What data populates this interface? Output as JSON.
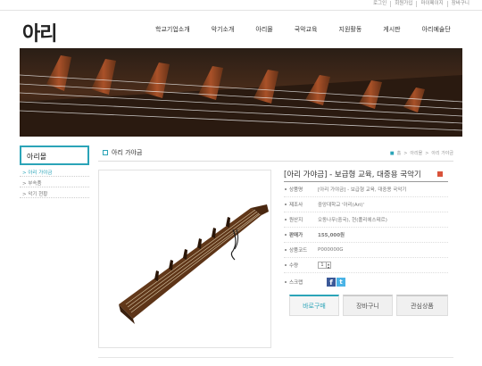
{
  "util": {
    "links": [
      "로그인",
      "회원가입",
      "마이페이지",
      "장바구니"
    ]
  },
  "header": {
    "logo": "아리",
    "nav": [
      "학교기업소개",
      "악기소개",
      "아리몰",
      "국악교육",
      "지원활동",
      "게시판",
      "아리예술단"
    ]
  },
  "sidebar": {
    "title": "아리몰",
    "items": [
      {
        "label": "아리 가야금",
        "active": true
      },
      {
        "label": "부속품",
        "active": false
      },
      {
        "label": "악기 현황",
        "active": false
      }
    ]
  },
  "main": {
    "page_title": "아리 가야금",
    "breadcrumb": [
      "홈",
      "아리몰",
      "아리 가야금"
    ]
  },
  "product": {
    "title": "[아리 가야금] - 보급형 교육, 대중용 국악기",
    "rows": [
      {
        "label": "상품명",
        "value": "[아리 가야금] - 보급형 교육, 대중용 국악기"
      },
      {
        "label": "제조사",
        "value": "중앙대학교 '아리(Ari)'"
      },
      {
        "label": "원산지",
        "value": "오동나무(중국), 현(폴리에스테르)"
      },
      {
        "label": "판매가",
        "value": "155,000원"
      },
      {
        "label": "상품코드",
        "value": "P000000G"
      },
      {
        "label": "수량",
        "value": "1"
      },
      {
        "label": "스크랩",
        "value": ""
      }
    ],
    "buttons": {
      "buy": "바로구매",
      "cart": "장바구니",
      "wish": "관심상품"
    }
  },
  "colors": {
    "accent": "#2ba4b8",
    "price": "#e0533b"
  }
}
